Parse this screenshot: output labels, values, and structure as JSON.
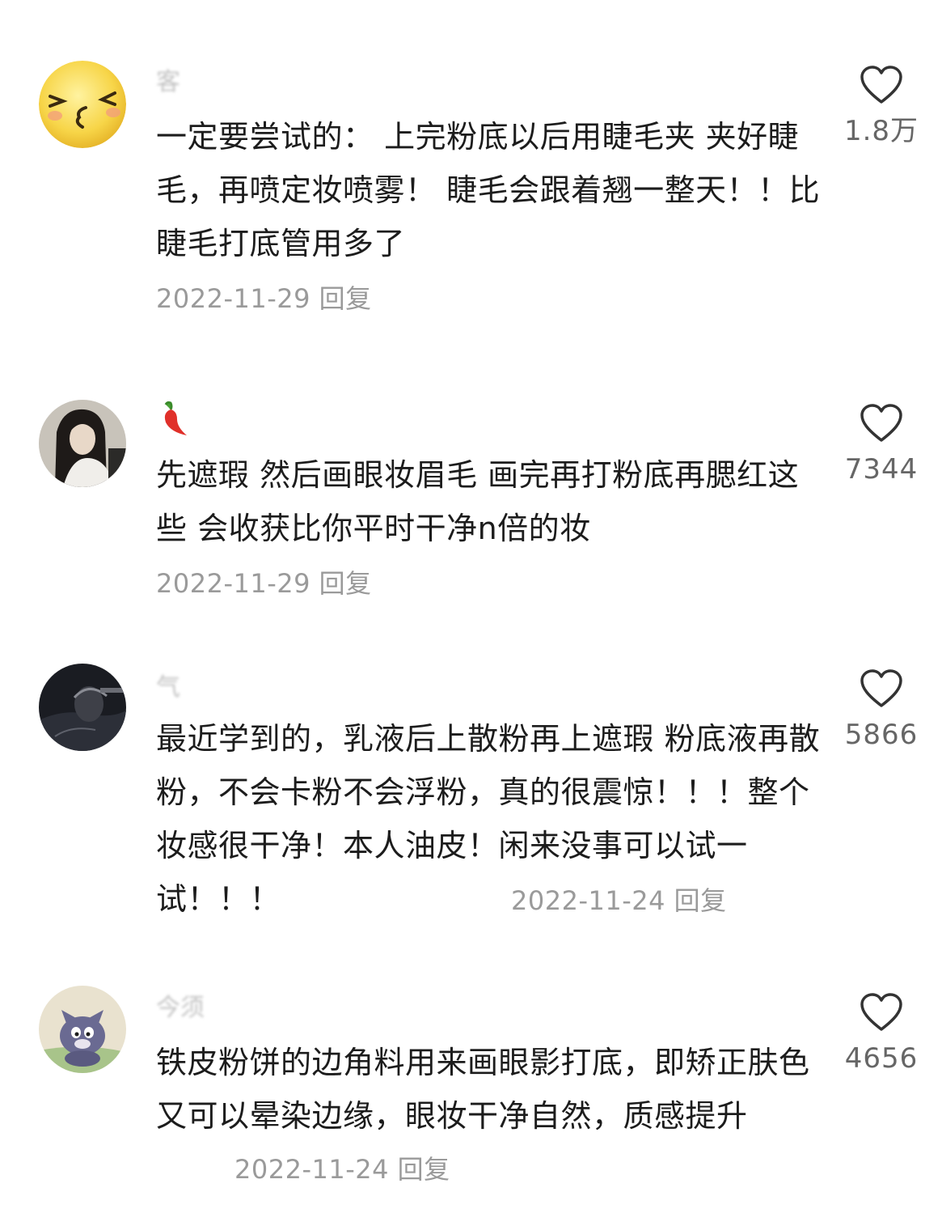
{
  "comments": [
    {
      "username": "客",
      "text": "一定要尝试的： 上完粉底以后用睫毛夹 夹好睫毛，再喷定妆喷雾！ 睫毛会跟着翘一整天！！比睫毛打底管用多了",
      "date": "2022-11-29",
      "reply": "回复",
      "likes": "1.8万",
      "avatar": "smiley-face-avatar"
    },
    {
      "username": "🌶️",
      "text": "先遮瑕 然后画眼妆眉毛 画完再打粉底再腮红这些 会收获比你平时干净n倍的妆",
      "date": "2022-11-29",
      "reply": "回复",
      "likes": "7344",
      "avatar": "woman-photo-avatar"
    },
    {
      "username": "气",
      "text": "最近学到的，乳液后上散粉再上遮瑕 粉底液再散粉，不会卡粉不会浮粉，真的很震惊！！！整个妆感很干净！本人油皮！闲来没事可以试一试！！！",
      "date": "2022-11-24",
      "reply": "回复",
      "likes": "5866",
      "avatar": "dark-photo-avatar"
    },
    {
      "username": "今须",
      "text": "铁皮粉饼的边角料用来画眼影打底，即矫正肤色又可以晕染边缘，眼妆干净自然，质感提升",
      "date": "2022-11-24",
      "reply": "回复",
      "likes": "4656",
      "avatar": "cartoon-cat-avatar"
    }
  ],
  "colors": {
    "text": "#1c1c1c",
    "meta": "#9a9a9a",
    "like_count": "#666666",
    "heart_outline": "#333333"
  }
}
